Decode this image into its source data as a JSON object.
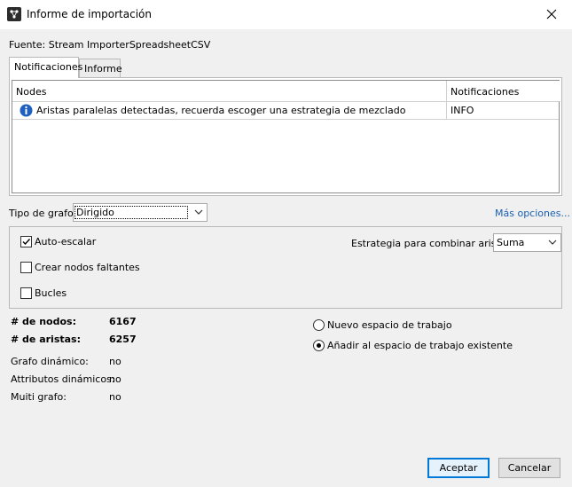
{
  "window": {
    "title": "Informe de importación"
  },
  "source": {
    "text": "Fuente:  Stream ImporterSpreadsheetCSV"
  },
  "tabs": [
    {
      "label": "Notificaciones",
      "active": true
    },
    {
      "label": "Informe",
      "active": false
    }
  ],
  "table": {
    "columns": [
      "Nodes",
      "Notificaciones"
    ],
    "rows": [
      {
        "icon": "info-icon",
        "message": "Aristas paralelas detectadas, recuerda escoger una estrategia de mezclado",
        "level": "INFO"
      }
    ]
  },
  "graph_type": {
    "label": "Tipo de grafo:",
    "value": "Dirigido"
  },
  "more_options": "Más opciones...",
  "options": {
    "auto_scale": {
      "label": "Auto-escalar",
      "checked": true
    },
    "create_missing": {
      "label": "Crear nodos faltantes",
      "checked": false
    },
    "loops": {
      "label": "Bucles",
      "checked": false
    },
    "merge_strategy": {
      "label": "Estrategia para combinar aristas:",
      "value": "Suma"
    }
  },
  "stats": {
    "nodes": {
      "label": "# de nodos:",
      "value": "6167"
    },
    "edges": {
      "label": "# de aristas:",
      "value": "6257"
    },
    "dynamic": {
      "label": "Grafo dinámico:",
      "value": "no"
    },
    "dyn_attrs": {
      "label": "Attributos dinámicos:",
      "value": "no"
    },
    "multi": {
      "label": "Muiti grafo:",
      "value": "no"
    }
  },
  "workspace": {
    "new": {
      "label": "Nuevo espacio de trabajo",
      "selected": false
    },
    "existing": {
      "label": "Añadir al espacio de trabajo existente",
      "selected": true
    }
  },
  "buttons": {
    "accept": "Aceptar",
    "cancel": "Cancelar"
  },
  "colors": {
    "accent": "#0078d7",
    "link": "#1a5fb4",
    "info_icon": "#1f5fbf"
  }
}
